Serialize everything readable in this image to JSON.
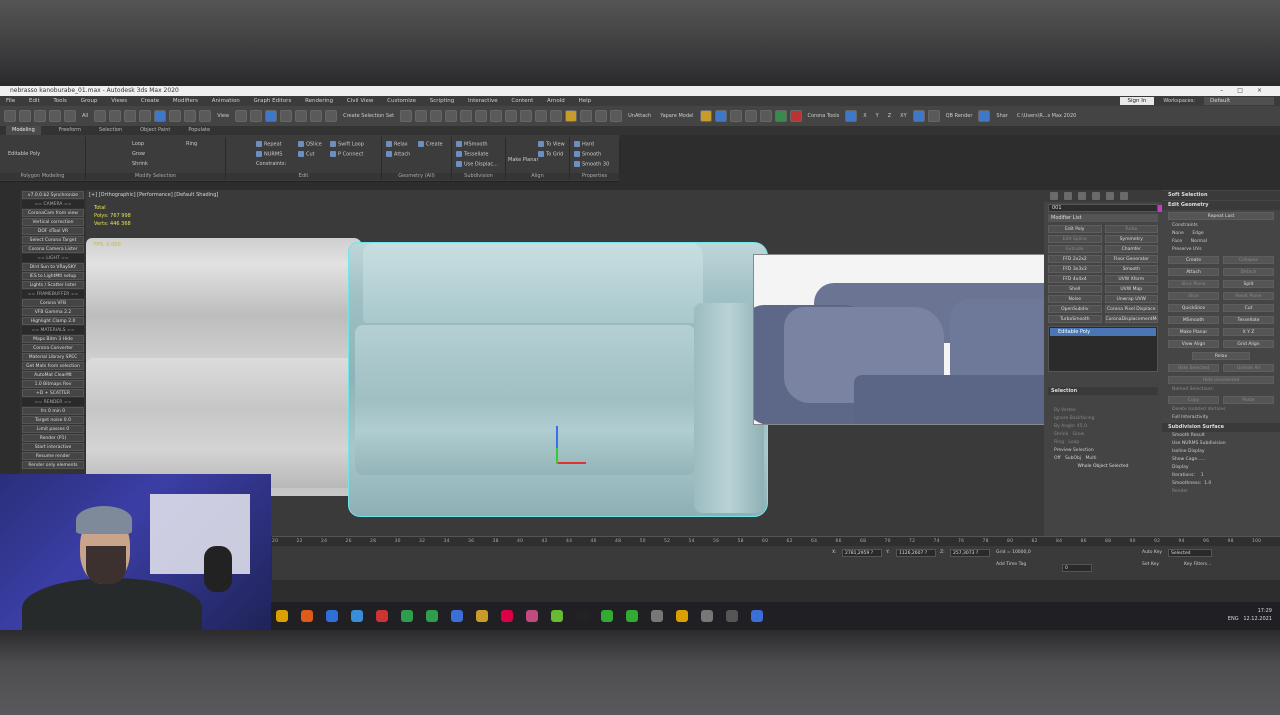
{
  "window": {
    "title": "nebrasso kanoburabe_01.max - Autodesk 3ds Max 2020"
  },
  "menu": {
    "items": [
      "File",
      "Edit",
      "Tools",
      "Group",
      "Views",
      "Create",
      "Modifiers",
      "Animation",
      "Graph Editors",
      "Rendering",
      "Civil View",
      "Customize",
      "Scripting",
      "Interactive",
      "Content",
      "Arnold",
      "Help"
    ],
    "sign_in": "Sign In",
    "workspaces_label": "Workspaces:",
    "workspaces_value": "Default"
  },
  "toolbar": {
    "filter_all": "All",
    "view": "View",
    "selection_set": "Create Selection Set",
    "unattach": "UnAttach",
    "vrayare_model": "Yapare Model",
    "corona_tools": "Corona Tools",
    "xyz": [
      "X",
      "Y",
      "Z",
      "XY"
    ],
    "qb_render": "QB Render",
    "share": "Shar",
    "project_path": "C:\\Users\\R...s Max 2020"
  },
  "ribbon": {
    "tabs": [
      "Modeling",
      "Freeform",
      "Selection",
      "Object Paint",
      "Populate"
    ],
    "groups": {
      "polygon_modeling": "Polygon Modeling",
      "modify_selection": "Modify Selection",
      "edit": "Edit",
      "geometry_all": "Geometry (All)",
      "subdivision": "Subdivision",
      "align": "Align",
      "properties": "Properties"
    },
    "edit_items": [
      "Repeat",
      "QSlice",
      "Swift Loop",
      "NURMS",
      "Cut",
      "P Connect",
      "Constraints:"
    ],
    "geometry_items": [
      "Relax",
      "Create",
      "Attach"
    ],
    "subdivision_items": [
      "MSmooth",
      "Tessellate",
      "Use Displac..."
    ],
    "align_items": [
      "To View",
      "To Grid"
    ],
    "properties_items": [
      "Hard",
      "Smooth",
      "Smooth 30"
    ],
    "make_planar": "Make Planar",
    "editable_poly": "Editable Poly",
    "modify_loop": "Loop",
    "modify_grow": "Grow",
    "modify_shrink": "Shrink",
    "modify_ring": "Ring"
  },
  "left_panel": {
    "rows": [
      "v7.0.0.b2  Synchronize",
      "== CAMERA ==",
      "CoronaCam from view",
      "Vertical correction",
      "DOF  dTool  VR",
      "Select  Corona  Target",
      "Corona Camera Lister",
      "== LIGHT ==",
      "Dlrd Sun to VRaySKY",
      "IES to  LightMtl setup",
      "Lights / Scatter lister",
      "== FRAMEBUFFER ==",
      "Corona VFB",
      "VFB Gamma   2.2",
      "Highlight Clamp  2.0",
      "== MATERIALS ==",
      "Maps  Bitm  3  Hide",
      "Corona Converter",
      "Material Library  SPEC",
      "Get Mats from selection",
      "AutoMat  ClearMt",
      "1.0  Bitmaps Rev",
      "+D  +  SCATTER",
      "== RENDER ==",
      "frs  0  min  0",
      "Target noise  0.0",
      "Limit passes  0",
      "Render (P1)",
      "Start interactive",
      "Resume render",
      "Render only elements"
    ]
  },
  "viewport": {
    "label": "[+] [Orthographic] [Performance] [Default Shading]",
    "stats_total": "Total",
    "stats_polys_label": "Polys:",
    "stats_polys": "767 998",
    "stats_verts_label": "Verts:",
    "stats_verts": "446 368",
    "fps": "FPS:  0.000"
  },
  "command_panel": {
    "object_name": "001",
    "modifier_list": "Modifier List",
    "modifiers": [
      "Edit Poly",
      "Turbo",
      "Edit Spline",
      "Symmetry",
      "Extrude",
      "Chamfer",
      "FFD 2x2x2",
      "Floor Generator",
      "FFD 3x3x3",
      "Smooth",
      "FFD 4x4x4",
      "UVW Xform",
      "Shell",
      "UVW Map",
      "Noise",
      "Unwrap UVW",
      "OpenSubdiv",
      "Corona Pixel Displace",
      "TurboSmooth",
      "CoronaDisplacementMod"
    ],
    "stack_item": "Editable Poly",
    "selection_rollout": "Selection",
    "selection_items": [
      "By Vertex",
      "Ignore Backfacing",
      "By Angle:  45.0",
      "Shrink",
      "Grow",
      "Ring",
      "Loop"
    ],
    "preview_selection": "Preview Selection",
    "preview_opts": [
      "Off",
      "SubObj",
      "Multi"
    ],
    "whole_object": "Whole Object Selected"
  },
  "right_panel": {
    "soft_selection": "Soft Selection",
    "edit_geometry": "Edit Geometry",
    "repeat_last": "Repeat Last",
    "constraints_label": "Constraints",
    "constraints": [
      "None",
      "Edge",
      "Face",
      "Normal"
    ],
    "preserve_uvs": "Preserve UVs",
    "create": "Create",
    "collapse": "Collapse",
    "attach": "Attach",
    "detach": "Detach",
    "slice_plane": "Slice Plane",
    "split": "Split",
    "slice": "Slice",
    "reset_plane": "Reset Plane",
    "quickslice": "QuickSlice",
    "cut": "Cut",
    "msmooth": "MSmooth",
    "tessellate": "Tessellate",
    "make_planar": "Make Planar",
    "xyz": "X  Y  Z",
    "view_align": "View Align",
    "grid_align": "Grid Align",
    "relax": "Relax",
    "hide_selected": "Hide Selected",
    "unhide_all": "Unhide All",
    "hide_unselected": "Hide Unselected",
    "named_selections": "Named Selections:",
    "copy": "Copy",
    "paste": "Paste",
    "delete_isolated": "Delete Isolated Vertices",
    "full_interactivity": "Full Interactivity",
    "subdivision_surface": "Subdivision Surface",
    "smooth_result": "Smooth Result",
    "use_nurms": "Use NURMS Subdivision",
    "isoline_display": "Isoline Display",
    "show_cage": "Show Cage......",
    "display": "Display",
    "iterations_label": "Iterations:",
    "iterations": "1",
    "smoothness_label": "Smoothness:",
    "smoothness": "1.0",
    "render": "Render"
  },
  "timeline": {
    "ticks": [
      "20",
      "22",
      "24",
      "26",
      "28",
      "30",
      "32",
      "34",
      "36",
      "38",
      "40",
      "42",
      "44",
      "46",
      "48",
      "50",
      "52",
      "54",
      "56",
      "58",
      "60",
      "62",
      "64",
      "66",
      "68",
      "70",
      "72",
      "74",
      "76",
      "78",
      "80",
      "82",
      "84",
      "86",
      "88",
      "90",
      "92",
      "94",
      "96",
      "98",
      "100"
    ]
  },
  "status": {
    "x_label": "X:",
    "x_val": "2781,2959 ?",
    "y_label": "Y:",
    "y_val": "1126,2607 ?",
    "z_label": "Z:",
    "z_val": "257,3073 ?",
    "grid": "Grid = 10000,0",
    "add_time_tag": "Add Time Tag",
    "auto_key": "Auto Key",
    "selected": "Selected",
    "set_key": "Set Key",
    "key_filters": "Key Filters...",
    "frame": "0"
  },
  "taskbar": {
    "time": "17:29",
    "date": "12.12.2021",
    "lang": "ENG"
  },
  "colors": {
    "accent": "#3d79c8",
    "selection_outline": "#6fe6ec",
    "object_color": "#c33bc3",
    "stats_yellow": "#e8e24a"
  }
}
